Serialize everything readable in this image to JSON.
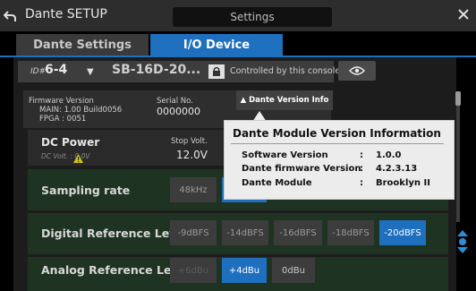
{
  "window": {
    "title": "Dante SETUP",
    "settings_label": "Settings"
  },
  "tabs": [
    {
      "label": "Dante Settings",
      "active": false
    },
    {
      "label": "I/O Device",
      "active": true
    }
  ],
  "device_bar": {
    "id_prefix": "ID#",
    "id_value": "6-4",
    "dropdown_glyph": "▼",
    "device_name": "SB-16D-20...",
    "controlled_text": "Controlled by this console"
  },
  "firmware": {
    "label": "Firmware Version",
    "main": "MAIN: 1.00 Build0056",
    "fpga": "FPGA : 0051",
    "serial_label": "Serial No.",
    "serial_value": "0000000",
    "version_info_button": "▲ Dante Version Info"
  },
  "dc_power": {
    "title": "DC Power",
    "dc_volt": "DC Volt. : 0.0V",
    "stop_label": "Stop Volt.",
    "stop_value": "12.0V"
  },
  "sampling_rate": {
    "label": "Sampling rate",
    "options": [
      "48kHz"
    ]
  },
  "digital_ref": {
    "label": "Digital Reference Level",
    "options": [
      "-9dBFS",
      "-14dBFS",
      "-16dBFS",
      "-18dBFS",
      "-20dBFS"
    ],
    "selected": "-20dBFS"
  },
  "analog_ref": {
    "label": "Analog Reference Level",
    "options": [
      "+6dBu",
      "+4dBu",
      "0dBu"
    ],
    "selected": "+4dBu"
  },
  "popup": {
    "title": "Dante Module Version Information",
    "rows": [
      {
        "label": "Software Version",
        "sep": ":",
        "value": "1.0.0"
      },
      {
        "label": "Dante firmware Version",
        "sep": ":",
        "value": "4.2.3.13"
      },
      {
        "label": "Dante Module",
        "sep": ":",
        "value": "Brooklyn II"
      }
    ]
  },
  "colors": {
    "accent": "#1f6fbf",
    "row_green": "#1f3323",
    "warning": "#d4c21a"
  }
}
